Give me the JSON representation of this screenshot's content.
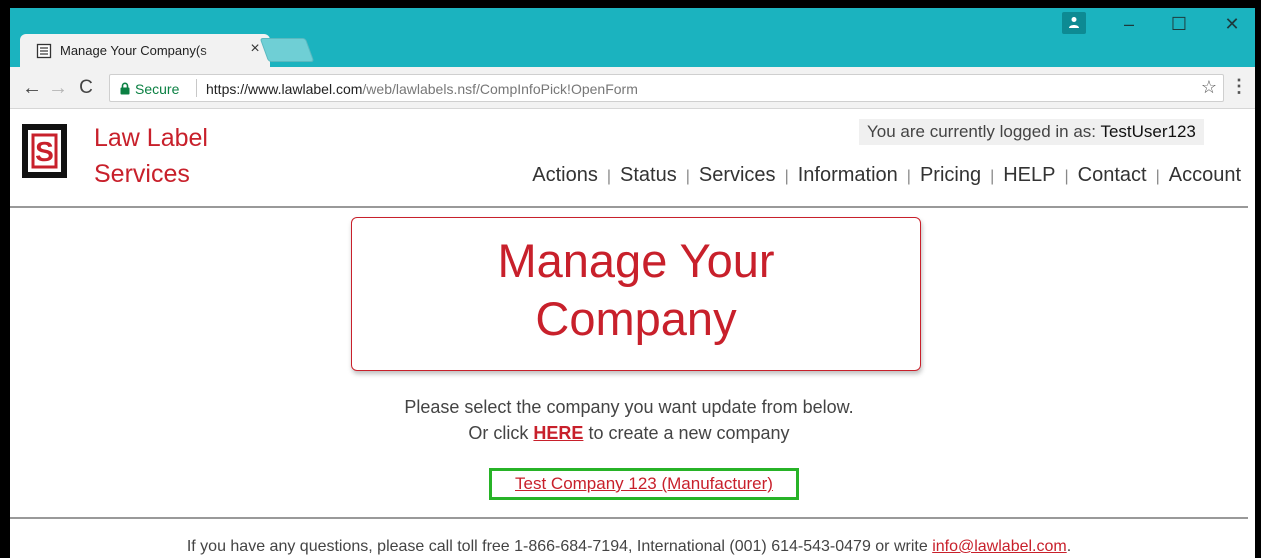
{
  "browser": {
    "tab_title": "Manage Your Company(s",
    "tab_close_glyph": "×",
    "window_controls": {
      "minimize": "–",
      "maximize": "☐",
      "close": "✕"
    },
    "nav": {
      "back": "←",
      "forward": "→",
      "reload": "C"
    },
    "secure_label": "Secure",
    "url_host": "https://www.lawlabel.com",
    "url_path": "/web/lawlabels.nsf/CompInfoPick!OpenForm",
    "star_glyph": "☆",
    "menu_glyph": "⋮",
    "accent_color": "#1bb3bf",
    "icons": [
      "document-icon",
      "profile-icon",
      "lock-icon",
      "star-icon",
      "menu-icon"
    ]
  },
  "header": {
    "brand_line1": "Law Label",
    "brand_line2": "Services",
    "logo_letter": "S",
    "logged_in_prefix": "You are currently logged in as: ",
    "logged_in_user": "TestUser123",
    "nav_items": [
      {
        "label": "Actions"
      },
      {
        "label": "Status"
      },
      {
        "label": "Services"
      },
      {
        "label": "Information"
      },
      {
        "label": "Pricing"
      },
      {
        "label": "HELP"
      },
      {
        "label": "Contact"
      },
      {
        "label": "Account"
      }
    ],
    "nav_separator": "|"
  },
  "main": {
    "title_line1": "Manage Your",
    "title_line2": "Company",
    "instruction_line1": "Please select the company you want update from below.",
    "instruction_prefix": "Or click ",
    "here_link": "HERE",
    "instruction_suffix": " to create a new company",
    "company_link": "Test Company 123 (Manufacturer)",
    "brand_color": "#c8202b",
    "highlight_color": "#27b327"
  },
  "footer": {
    "text": "If you have any questions, please call toll free 1-866-684-7194, International (001) 614-543-0479 or write ",
    "email": "info@lawlabel.com",
    "end": "."
  }
}
